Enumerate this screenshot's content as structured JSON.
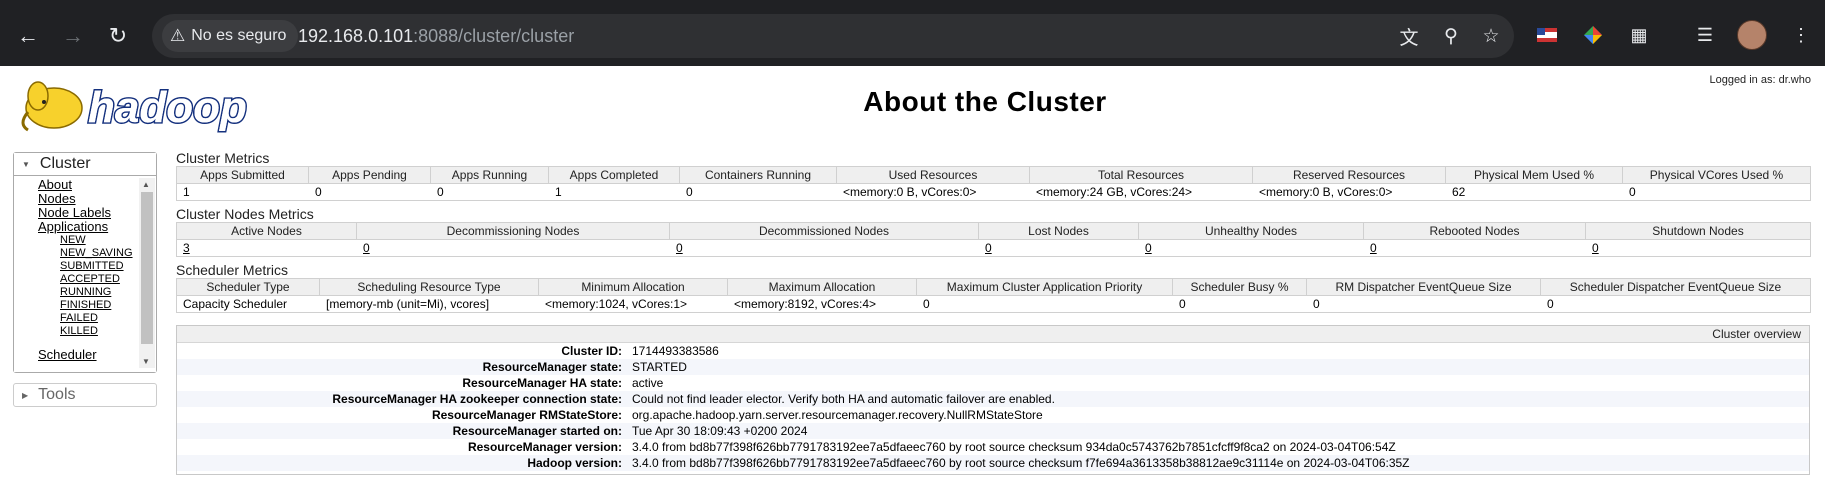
{
  "browser": {
    "security_label": "No es seguro",
    "url_host": "192.168.0.101",
    "url_rest": ":8088/cluster/cluster",
    "icons": {
      "back": "back-arrow-icon",
      "forward": "forward-arrow-icon",
      "reload": "reload-icon",
      "translate": "translate-icon",
      "zoom": "zoom-icon",
      "bookmark": "star-icon"
    }
  },
  "header": {
    "logo_text": "hadoop",
    "logged_in": "Logged in as: dr.who",
    "title": "About the Cluster"
  },
  "sidebar": {
    "cluster_label": "Cluster",
    "items": [
      "About",
      "Nodes",
      "Node Labels",
      "Applications"
    ],
    "app_states": [
      "NEW",
      "NEW_SAVING",
      "SUBMITTED",
      "ACCEPTED",
      "RUNNING",
      "FINISHED",
      "FAILED",
      "KILLED"
    ],
    "scheduler_label": "Scheduler",
    "tools_label": "Tools"
  },
  "cluster_metrics": {
    "title": "Cluster Metrics",
    "headers": [
      "Apps Submitted",
      "Apps Pending",
      "Apps Running",
      "Apps Completed",
      "Containers Running",
      "Used Resources",
      "Total Resources",
      "Reserved Resources",
      "Physical Mem Used %",
      "Physical VCores Used %"
    ],
    "values": [
      "1",
      "0",
      "0",
      "1",
      "0",
      "<memory:0 B, vCores:0>",
      "<memory:24 GB, vCores:24>",
      "<memory:0 B, vCores:0>",
      "62",
      "0"
    ]
  },
  "nodes_metrics": {
    "title": "Cluster Nodes Metrics",
    "headers": [
      "Active Nodes",
      "Decommissioning Nodes",
      "Decommissioned Nodes",
      "Lost Nodes",
      "Unhealthy Nodes",
      "Rebooted Nodes",
      "Shutdown Nodes"
    ],
    "values": [
      "3",
      "0",
      "0",
      "0",
      "0",
      "0",
      "0"
    ]
  },
  "scheduler_metrics": {
    "title": "Scheduler Metrics",
    "headers": [
      "Scheduler Type",
      "Scheduling Resource Type",
      "Minimum Allocation",
      "Maximum Allocation",
      "Maximum Cluster Application Priority",
      "Scheduler Busy %",
      "RM Dispatcher EventQueue Size",
      "Scheduler Dispatcher EventQueue Size"
    ],
    "values": [
      "Capacity Scheduler",
      "[memory-mb (unit=Mi), vcores]",
      "<memory:1024, vCores:1>",
      "<memory:8192, vCores:4>",
      "0",
      "0",
      "0",
      "0"
    ]
  },
  "overview": {
    "title": "Cluster overview",
    "rows": [
      {
        "k": "Cluster ID:",
        "v": "1714493383586"
      },
      {
        "k": "ResourceManager state:",
        "v": "STARTED"
      },
      {
        "k": "ResourceManager HA state:",
        "v": "active"
      },
      {
        "k": "ResourceManager HA zookeeper connection state:",
        "v": "Could not find leader elector. Verify both HA and automatic failover are enabled."
      },
      {
        "k": "ResourceManager RMStateStore:",
        "v": "org.apache.hadoop.yarn.server.resourcemanager.recovery.NullRMStateStore"
      },
      {
        "k": "ResourceManager started on:",
        "v": "Tue Apr 30 18:09:43 +0200 2024"
      },
      {
        "k": "ResourceManager version:",
        "v": "3.4.0 from bd8b77f398f626bb7791783192ee7a5dfaeec760 by root source checksum 934da0c5743762b7851cfcff9f8ca2 on 2024-03-04T06:54Z"
      },
      {
        "k": "Hadoop version:",
        "v": "3.4.0 from bd8b77f398f626bb7791783192ee7a5dfaeec760 by root source checksum f7fe694a3613358b38812ae9c31114e on 2024-03-04T06:35Z"
      }
    ]
  }
}
